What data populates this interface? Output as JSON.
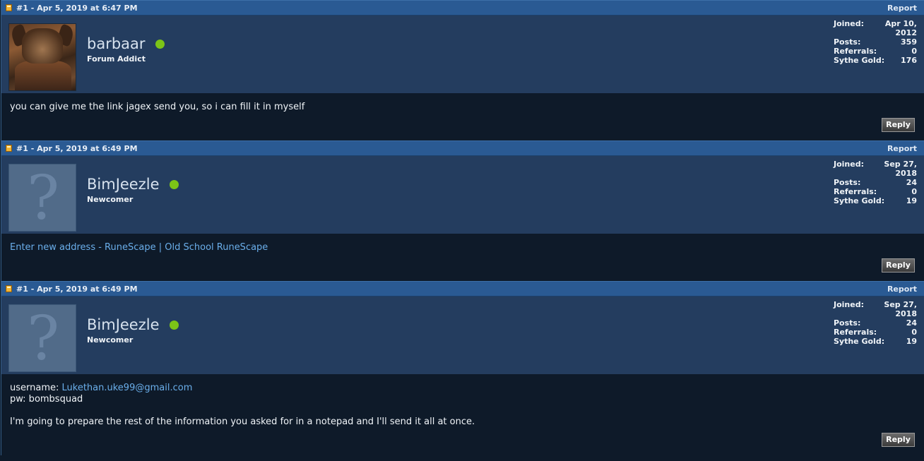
{
  "posts": [
    {
      "header": "#1 - Apr 5, 2019 at 6:47 PM",
      "report_label": "Report",
      "user": {
        "name": "barbaar",
        "title": "Forum Addict",
        "avatar": "custom",
        "online": true
      },
      "stats": [
        {
          "label": "Joined:",
          "value": "Apr 10, 2012"
        },
        {
          "label": "Posts:",
          "value": "359"
        },
        {
          "label": "Referrals:",
          "value": "0"
        },
        {
          "label": "Sythe Gold:",
          "value": "176"
        }
      ],
      "body": {
        "line1": "you can give me the link jagex send you, so i can fill it in myself"
      },
      "reply_label": "Reply"
    },
    {
      "header": "#1 - Apr 5, 2019 at 6:49 PM",
      "report_label": "Report",
      "user": {
        "name": "BimJeezle",
        "title": "Newcomer",
        "avatar": "default",
        "online": true
      },
      "stats": [
        {
          "label": "Joined:",
          "value": "Sep 27, 2018"
        },
        {
          "label": "Posts:",
          "value": "24"
        },
        {
          "label": "Referrals:",
          "value": "0"
        },
        {
          "label": "Sythe Gold:",
          "value": "19"
        }
      ],
      "body": {
        "link": "Enter new address - RuneScape | Old School RuneScape"
      },
      "reply_label": "Reply"
    },
    {
      "header": "#1 - Apr 5, 2019 at 6:49 PM",
      "report_label": "Report",
      "user": {
        "name": "BimJeezle",
        "title": "Newcomer",
        "avatar": "default",
        "online": true
      },
      "stats": [
        {
          "label": "Joined:",
          "value": "Sep 27, 2018"
        },
        {
          "label": "Posts:",
          "value": "24"
        },
        {
          "label": "Referrals:",
          "value": "0"
        },
        {
          "label": "Sythe Gold:",
          "value": "19"
        }
      ],
      "body": {
        "username_label": "username: ",
        "username_value": "Lukethan.uke99@gmail.com",
        "pw_line": "pw: bombsquad",
        "message": "I'm going to prepare the rest of the information you asked for in a notepad and I'll send it all at once."
      },
      "reply_label": "Reply"
    }
  ],
  "colors": {
    "header_bg": "#2a5a93",
    "user_panel_bg": "#243d5f",
    "body_bg": "#0e1a29",
    "link": "#6aaeea",
    "online": "#7cc417"
  },
  "icons": {
    "post_icon": "post-icon",
    "online_indicator": "online-dot-icon",
    "default_avatar": "question-mark-icon"
  }
}
